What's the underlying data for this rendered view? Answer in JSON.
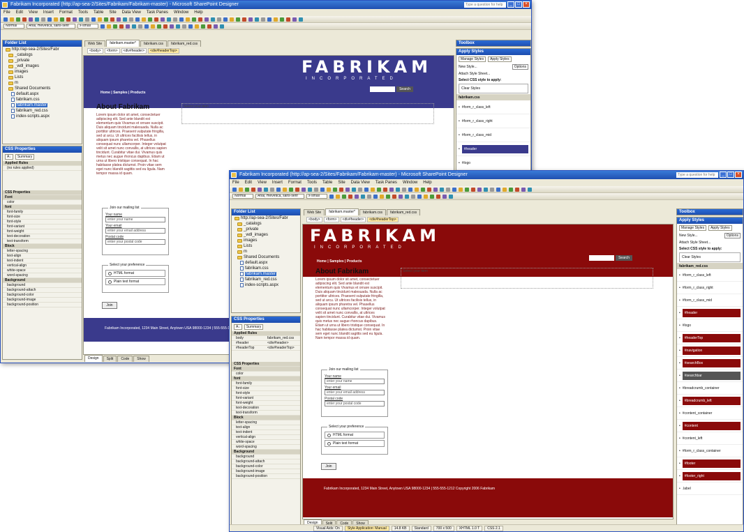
{
  "back_window": {
    "title": "Fabrikam Incorporated (http://ap-sea-2/Sites/Fabrikam/Fabrikam-master) - Microsoft SharePoint Designer",
    "menu": [
      "File",
      "Edit",
      "View",
      "Insert",
      "Format",
      "Tools",
      "Table",
      "Site",
      "Data View",
      "Task Panes",
      "Window",
      "Help"
    ],
    "style_select": "Normal",
    "font_select": "Arial, Helvetica, sans-serif",
    "size_select": "x-small",
    "folder_list_title": "Folder List",
    "tree": [
      "http://ap-sea-2/Sites/Fabr",
      "_catalogs",
      "_private",
      "_wdl_images",
      "images",
      "Lists",
      "m",
      "Shared Documents",
      "default.aspx",
      "fabrikam.css",
      "fabrikam.master",
      "fabrikam_red.css",
      "index-scripts.aspx"
    ],
    "css_props_title": "CSS Properties",
    "applied_rules_label": "Applied Rules",
    "no_rules": "(no rules applied)",
    "css_props_label": "CSS Properties",
    "props": [
      {
        "name": "Font",
        "cat": true
      },
      {
        "name": "color"
      },
      {
        "name": "font",
        "cat": true
      },
      {
        "name": "font-family"
      },
      {
        "name": "font-size"
      },
      {
        "name": "font-style"
      },
      {
        "name": "font-variant"
      },
      {
        "name": "font-weight"
      },
      {
        "name": "text-decoration"
      },
      {
        "name": "text-transform"
      },
      {
        "name": "Block",
        "cat": true
      },
      {
        "name": "letter-spacing"
      },
      {
        "name": "text-align"
      },
      {
        "name": "text-indent"
      },
      {
        "name": "vertical-align"
      },
      {
        "name": "white-space"
      },
      {
        "name": "word-spacing"
      },
      {
        "name": "Background",
        "cat": true
      },
      {
        "name": "background"
      },
      {
        "name": "background-attach"
      },
      {
        "name": "background-color"
      },
      {
        "name": "background-image"
      },
      {
        "name": "background-position"
      }
    ],
    "tabs": [
      "Web Site",
      "fabrikam.master*",
      "fabrikam.css",
      "fabrikam_red.css"
    ],
    "crumbs": [
      "<body>",
      "<form>",
      "<div#header>",
      "<div#headerTop>"
    ],
    "logo": "FABRIKAM",
    "logo_sub": "INCORPORATED",
    "search_btn": "Search",
    "nav": "Home | Samples | Products",
    "about_heading": "About Fabrikam",
    "lorem": "Lorem ipsum dolor sit amet, consectetuer adipiscing elit. Sed ante blandit est elementum quis Vivamus et ornare suscipit. Duis aliquam tincidunt malesuada. Nulla ac porttitor ultrices. Praesent vulputate fringilla, sed ut arcu. Ut ultrices facilisis tellus, in aliquam ipsum pharetra vel. Phasellus consequat nunc ullamcorper. Integer volutpat velit sit amet nunc convallis, at ultrices sapien tincidunt. Curabitur vitae dui. Vivamus quis metus nec augue rhoncus dapibus. Etiam ut urna ut libero tristique consequat. In hac habitasse platea dictumst. Proin vitae sem eget nunc blandit sagittis sed eu ligula. Nam tempor massa id quam.",
    "select_box": "Select your item",
    "newsletter_legend": "Join our mailing list",
    "name_label": "Your name",
    "name_input": "enter your name",
    "email_label": "Your email",
    "email_input": "enter your email address",
    "zip_label": "Postal code",
    "zip_input": "enter your postal code",
    "pref_legend": "Select your preference",
    "pref_1": "HTML format",
    "pref_2": "Plain text format",
    "join_btn": "Join",
    "footer": "Fabrikam Incorporated, 1234 Main Street, Anytown USA 98000-1234 | 555-555-1212\nCopyright 2006 Fabrikam",
    "view_tabs": [
      "Design",
      "Split",
      "Code",
      "Show"
    ],
    "toolbox_title": "Toolbox",
    "apply_styles_title": "Apply Styles",
    "manage_styles_tab": "Manage Styles",
    "apply_styles_tab": "Apply Styles",
    "new_style": "New Style...",
    "options": "Options",
    "attach_style": "Attach Style Sheet...",
    "select_css": "Select CSS style to apply:",
    "clear_styles": "Clear Styles",
    "sheet_name": "fabrikam.css",
    "styles": [
      "#form_r_class_left",
      "#form_r_class_right",
      "#form_r_class_mid",
      "#header",
      "#logo"
    ]
  },
  "front_window": {
    "title": "Fabrikam Incorporated (http://ap-sea-2/Sites/Fabrikam/Fabrikam-master) - Microsoft SharePoint Designer",
    "menu": [
      "File",
      "Edit",
      "View",
      "Insert",
      "Format",
      "Tools",
      "Table",
      "Site",
      "Data View",
      "Task Panes",
      "Window",
      "Help"
    ],
    "style_select": "Normal",
    "font_select": "Arial, Helvetica, sans-serif",
    "size_select": "x-small",
    "folder_list_title": "Folder List",
    "tree": [
      "http://ap-sea-2/Sites/Fabr",
      "_catalogs",
      "_private",
      "_wdl_images",
      "images",
      "Lists",
      "m",
      "Shared Documents",
      "default.aspx",
      "fabrikam.css",
      "fabrikam.master",
      "fabrikam_red.css",
      "index-scripts.aspx"
    ],
    "css_props_title": "CSS Properties",
    "applied_rules": [
      [
        "body",
        "fabrikam_red.css"
      ],
      [
        "#header",
        "<div#header>"
      ],
      [
        "#headerTop",
        "<div#headerTop>"
      ]
    ],
    "applied_rules_label": "Applied Rules",
    "css_props_label": "CSS Properties",
    "props": [
      {
        "name": "Font",
        "cat": true
      },
      {
        "name": "color"
      },
      {
        "name": "font",
        "cat": true
      },
      {
        "name": "font-family"
      },
      {
        "name": "font-size"
      },
      {
        "name": "font-style"
      },
      {
        "name": "font-variant"
      },
      {
        "name": "font-weight"
      },
      {
        "name": "text-decoration"
      },
      {
        "name": "text-transform"
      },
      {
        "name": "Block",
        "cat": true
      },
      {
        "name": "letter-spacing"
      },
      {
        "name": "text-align"
      },
      {
        "name": "text-indent"
      },
      {
        "name": "vertical-align"
      },
      {
        "name": "white-space"
      },
      {
        "name": "word-spacing"
      },
      {
        "name": "Background",
        "cat": true
      },
      {
        "name": "background"
      },
      {
        "name": "background-attach"
      },
      {
        "name": "background-color"
      },
      {
        "name": "background-image"
      },
      {
        "name": "background-position"
      }
    ],
    "tabs": [
      "Web Site",
      "fabrikam.master*",
      "fabrikam.css",
      "fabrikam_red.css"
    ],
    "crumbs": [
      "<body>",
      "<form>",
      "<div#header>",
      "<div#headerTop>"
    ],
    "logo": "FABRIKAM",
    "logo_sub": "INCORPORATED",
    "search_btn": "Search",
    "nav": "Home | Samples | Products",
    "about_heading": "About Fabrikam",
    "lorem": "Lorem ipsum dolor sit amet, consectetuer adipiscing elit. Sed ante blandit est elementum quis Vivamus et ornare suscipit. Duis aliquam tincidunt malesuada. Nulla ac porttitor ultrices. Praesent vulputate fringilla, sed ut arcu. Ut ultrices facilisis tellus, in aliquam ipsum pharetra vel. Phasellus consequat nunc ullamcorper. Integer volutpat velit sit amet nunc convallis, at ultrices sapien tincidunt. Curabitur vitae dui. Vivamus quis metus nec augue rhoncus dapibus. Etiam ut urna ut libero tristique consequat. In hac habitasse platea dictumst. Proin vitae sem eget nunc blandit sagittis sed eu ligula. Nam tempor massa id quam.",
    "select_box": "Select your item",
    "newsletter_legend": "Join our mailing list",
    "name_label": "Your name",
    "name_input": "enter your name",
    "email_label": "Your email",
    "email_input": "enter your email address",
    "zip_label": "Postal code",
    "zip_input": "enter your postal code",
    "pref_legend": "Select your preference",
    "pref_1": "HTML format",
    "pref_2": "Plain text format",
    "join_btn": "Join",
    "footer": "Fabrikam Incorporated, 1234 Main Street, Anytown USA 98000-1234 | 555-555-1212\nCopyright 2006 Fabrikam",
    "view_tabs": [
      "Design",
      "Split",
      "Code",
      "Show"
    ],
    "status": [
      "Visual Aids: On",
      "Style Application: Manual",
      "14.8 KB",
      "Standard",
      "700 x 500",
      "XHTML 1.0 T",
      "CSS 2.1"
    ],
    "toolbox_title": "Toolbox",
    "apply_styles_title": "Apply Styles",
    "manage_styles_tab": "Manage Styles",
    "apply_styles_tab": "Apply Styles",
    "new_style": "New Style...",
    "options": "Options",
    "attach_style": "Attach Style Sheet...",
    "select_css": "Select CSS style to apply:",
    "clear_styles": "Clear Styles",
    "sheet_name": "fabrikam_red.css",
    "styles": [
      "#form_r_class_left",
      "#form_r_class_right",
      "#form_r_class_mid",
      "#header",
      "#logo",
      "#headerTop",
      "#navigation",
      "#searchBox",
      "#searchbar",
      "#breadcrumb_container",
      "#breadcrumb_left",
      "#content_container",
      "#content",
      "#content_left",
      "#form_r_class_container",
      "#footer",
      "#footer_right",
      ".label"
    ]
  },
  "colors": {
    "back_theme": "#3a3a8c",
    "front_theme": "#8a0a0a",
    "chrome": "#ece9d8",
    "titlebar": "#1f4fb0"
  }
}
